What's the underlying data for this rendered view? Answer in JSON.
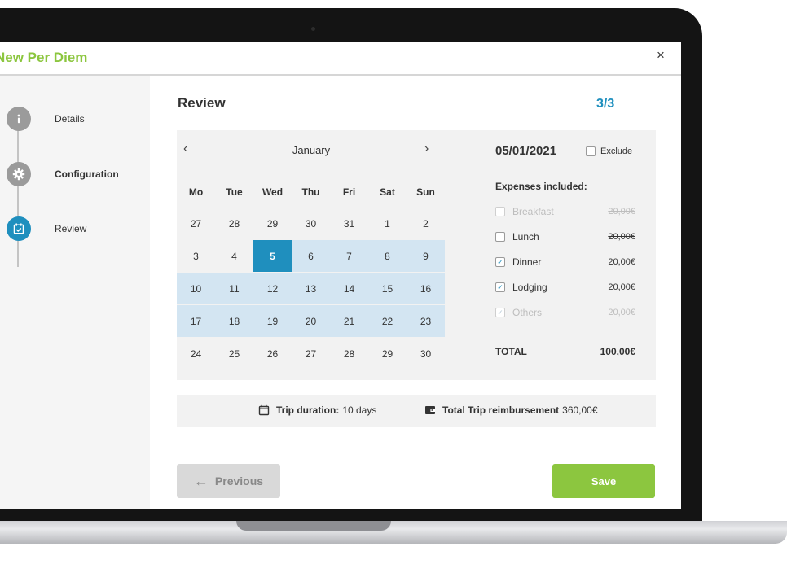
{
  "app": {
    "title": "New Per Diem",
    "close_glyph": "×"
  },
  "sidebar": {
    "steps": [
      {
        "label": "Details",
        "icon": "info-icon",
        "state": "done"
      },
      {
        "label": "Configuration",
        "icon": "gear-icon",
        "state": "done"
      },
      {
        "label": "Review",
        "icon": "calendar-check-icon",
        "state": "active"
      }
    ]
  },
  "main": {
    "title": "Review",
    "step_counter": "3/3"
  },
  "calendar": {
    "month": "January",
    "prev_glyph": "‹",
    "next_glyph": "›",
    "weekdays": [
      "Mo",
      "Tue",
      "Wed",
      "Thu",
      "Fri",
      "Sat",
      "Sun"
    ],
    "weeks": [
      [
        "27",
        "28",
        "29",
        "30",
        "31",
        "1",
        "2"
      ],
      [
        "3",
        "4",
        "5",
        "6",
        "7",
        "8",
        "9"
      ],
      [
        "10",
        "11",
        "12",
        "13",
        "14",
        "15",
        "16"
      ],
      [
        "17",
        "18",
        "19",
        "20",
        "21",
        "22",
        "23"
      ],
      [
        "24",
        "25",
        "26",
        "27",
        "28",
        "29",
        "30"
      ]
    ],
    "selected_day": "5",
    "trip_range": {
      "from": "5",
      "to": "23"
    }
  },
  "expenses": {
    "date": "05/01/2021",
    "exclude_label": "Exclude",
    "exclude_checked": false,
    "heading": "Expenses included:",
    "items": [
      {
        "name": "Breakfast",
        "amount": "20,00€",
        "checked": false,
        "disabled": true,
        "strikethrough": true
      },
      {
        "name": "Lunch",
        "amount": "20,00€",
        "checked": false,
        "disabled": false,
        "strikethrough": true
      },
      {
        "name": "Dinner",
        "amount": "20,00€",
        "checked": true,
        "disabled": false,
        "strikethrough": false
      },
      {
        "name": "Lodging",
        "amount": "20,00€",
        "checked": true,
        "disabled": false,
        "strikethrough": false
      },
      {
        "name": "Others",
        "amount": "20,00€",
        "checked": true,
        "disabled": true,
        "strikethrough": false
      }
    ],
    "total_label": "TOTAL",
    "total_value": "100,00€"
  },
  "summary": {
    "duration_label": "Trip duration:",
    "duration_value": "10 days",
    "reimbursement_label": "Total Trip reimbursement",
    "reimbursement_value": "360,00€"
  },
  "footer": {
    "previous_label": "Previous",
    "previous_glyph": "←",
    "save_label": "Save"
  },
  "colors": {
    "accent_green": "#8cc63f",
    "accent_blue": "#1f8fbe",
    "range_blue": "#d3e5f2"
  }
}
